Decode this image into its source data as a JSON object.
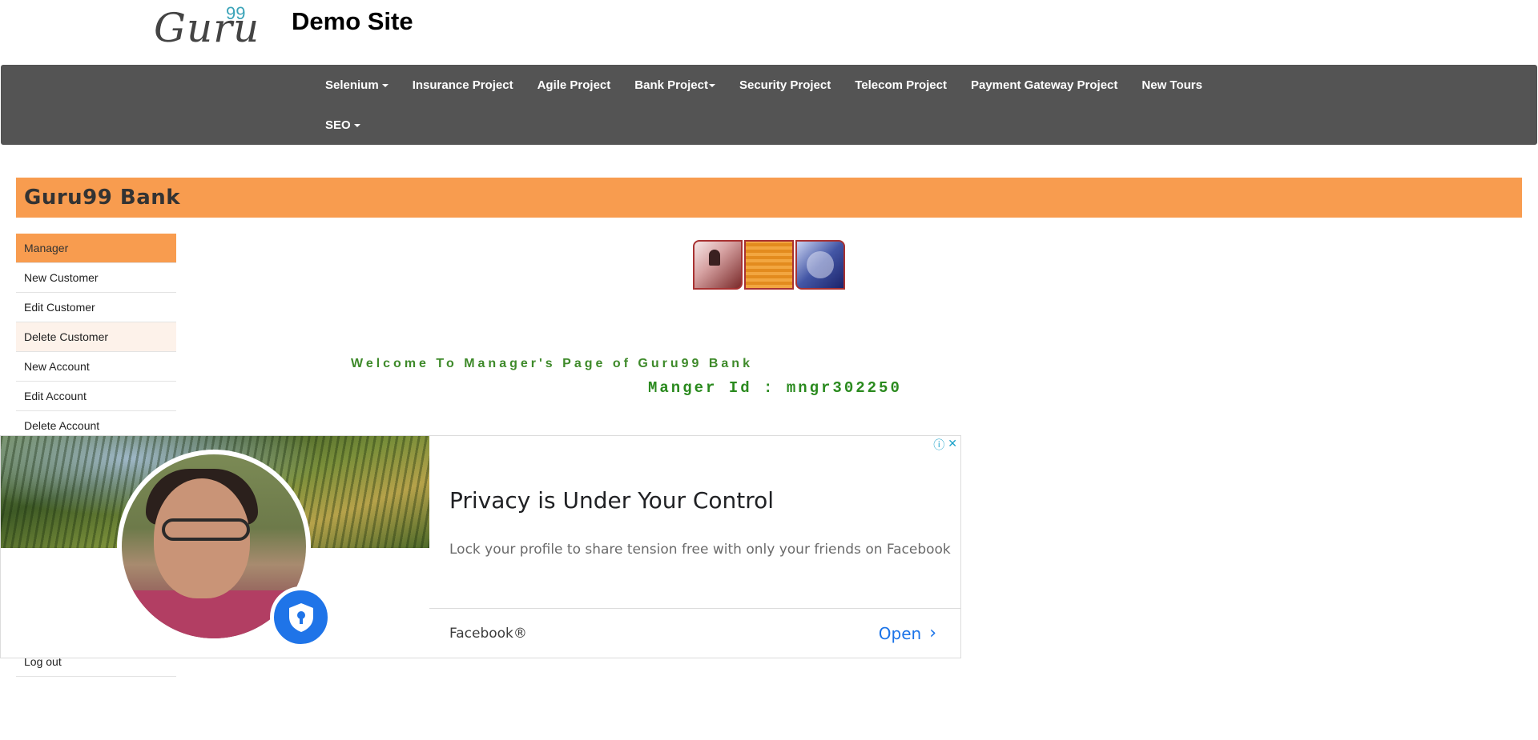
{
  "header": {
    "logo_text": "Guru",
    "logo_sup": "99",
    "site_title": "Demo Site"
  },
  "navbar": {
    "row1": [
      {
        "label": "Selenium",
        "dropdown": true
      },
      {
        "label": "Insurance Project",
        "dropdown": false
      },
      {
        "label": "Agile Project",
        "dropdown": false
      },
      {
        "label": "Bank Project",
        "dropdown": true
      },
      {
        "label": "Security Project",
        "dropdown": false
      },
      {
        "label": "Telecom Project",
        "dropdown": false
      },
      {
        "label": "Payment Gateway Project",
        "dropdown": false
      },
      {
        "label": "New Tours",
        "dropdown": false
      }
    ],
    "row2": [
      {
        "label": "SEO",
        "dropdown": true
      }
    ]
  },
  "bank": {
    "title": "Guru99 Bank"
  },
  "sidebar": {
    "items": [
      {
        "label": "Manager",
        "state": "active"
      },
      {
        "label": "New Customer",
        "state": ""
      },
      {
        "label": "Edit Customer",
        "state": ""
      },
      {
        "label": "Delete Customer",
        "state": "hover"
      },
      {
        "label": "New Account",
        "state": ""
      },
      {
        "label": "Edit Account",
        "state": ""
      },
      {
        "label": "Delete Account",
        "state": ""
      }
    ],
    "logout": "Log out"
  },
  "main": {
    "welcome": "Welcome To Manager's Page of Guru99 Bank",
    "manager_id": "Manger Id : mngr302250"
  },
  "ad": {
    "headline": "Privacy is Under Your Control",
    "body": "Lock your profile to share tension free with only your friends on Facebook",
    "brand": "Facebook®",
    "cta": "Open",
    "cta_icon": "chevron-right-icon",
    "info_icon": "info-icon",
    "close_icon": "close-icon",
    "brand_color": "#1f74e8"
  },
  "colors": {
    "navbar": "#545454",
    "accent": "#f89c4f",
    "welcome_green": "#3e8a2a",
    "manager_id_green": "#2a8a1e"
  }
}
